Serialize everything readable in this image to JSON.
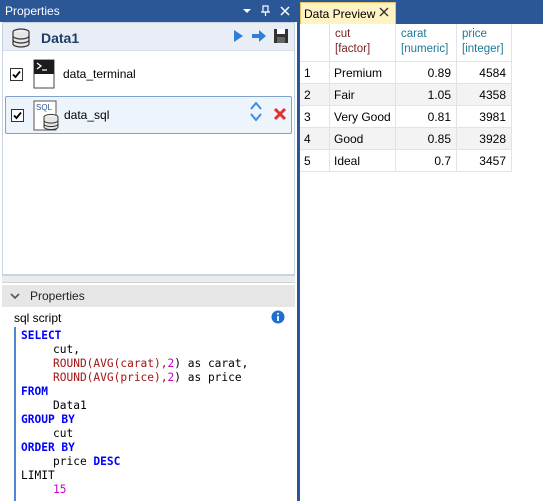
{
  "left_panel": {
    "title": "Properties",
    "dataset_name": "Data1",
    "items": [
      {
        "label": "data_terminal",
        "checked": true
      },
      {
        "label": "data_sql",
        "checked": true
      }
    ]
  },
  "properties": {
    "header": "Properties",
    "field_label": "sql script",
    "sql": {
      "select": "SELECT",
      "cut": "cut,",
      "round1_fn": "ROUND(AVG(carat),",
      "round1_num": "2",
      "round1_tail": ") as carat,",
      "round2_fn": "ROUND(AVG(price),",
      "round2_num": "2",
      "round2_tail": ") as price",
      "from": "FROM",
      "data1": "Data1",
      "group_by": "GROUP BY",
      "cut2": "cut",
      "order_by": "ORDER BY",
      "price_desc_1": "price ",
      "price_desc_2": "DESC",
      "limit": "LIMIT",
      "limit_val": "15"
    }
  },
  "preview": {
    "tab_label": "Data Preview",
    "columns": [
      {
        "name": "cut",
        "type": "[factor]"
      },
      {
        "name": "carat",
        "type": "[numeric]"
      },
      {
        "name": "price",
        "type": "[integer]"
      }
    ],
    "rows": [
      {
        "index": "1",
        "cut": "Premium",
        "carat": "0.89",
        "price": "4584"
      },
      {
        "index": "2",
        "cut": "Fair",
        "carat": "1.05",
        "price": "4358"
      },
      {
        "index": "3",
        "cut": "Very Good",
        "carat": "0.81",
        "price": "3981"
      },
      {
        "index": "4",
        "cut": "Good",
        "carat": "0.85",
        "price": "3928"
      },
      {
        "index": "5",
        "cut": "Ideal",
        "carat": "0.7",
        "price": "3457"
      }
    ]
  },
  "colors": {
    "chrome_blue": "#2b5797",
    "keyword": "#0000ff",
    "function": "#a31515",
    "number": "#cc00cc",
    "header_cut": "#7a1f1f",
    "header_numeric": "#1a7a9a",
    "tab_background": "#fff3c4"
  }
}
